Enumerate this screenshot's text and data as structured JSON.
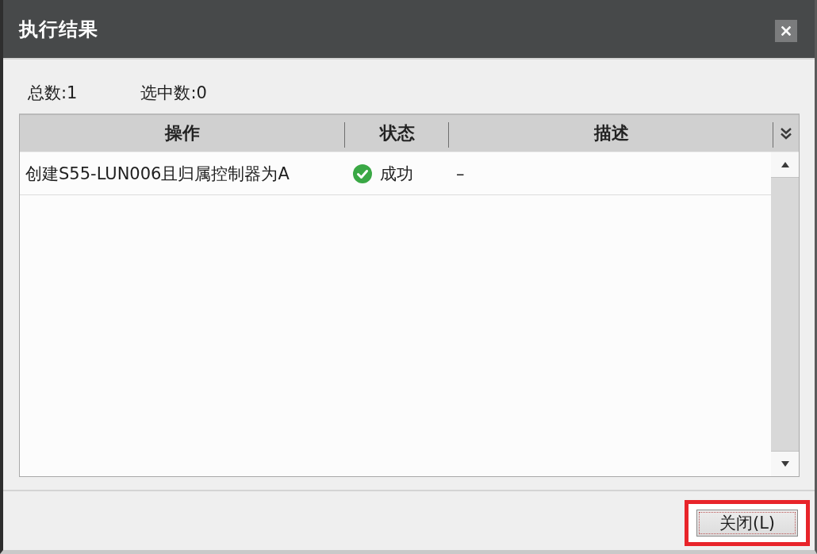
{
  "window": {
    "title": "执行结果"
  },
  "summary": {
    "total": "总数:1",
    "selected_count": "选中数:0"
  },
  "table": {
    "columns": [
      "操作",
      "状态",
      "描述"
    ],
    "rows": [
      {
        "operation": "创建S55-LUN006且归属控制器为A",
        "status": {
          "kind": "success",
          "text": "成功"
        },
        "description": "–"
      }
    ]
  },
  "buttons": [
    {
      "label": "关闭(L)",
      "highlighted": true
    }
  ]
}
